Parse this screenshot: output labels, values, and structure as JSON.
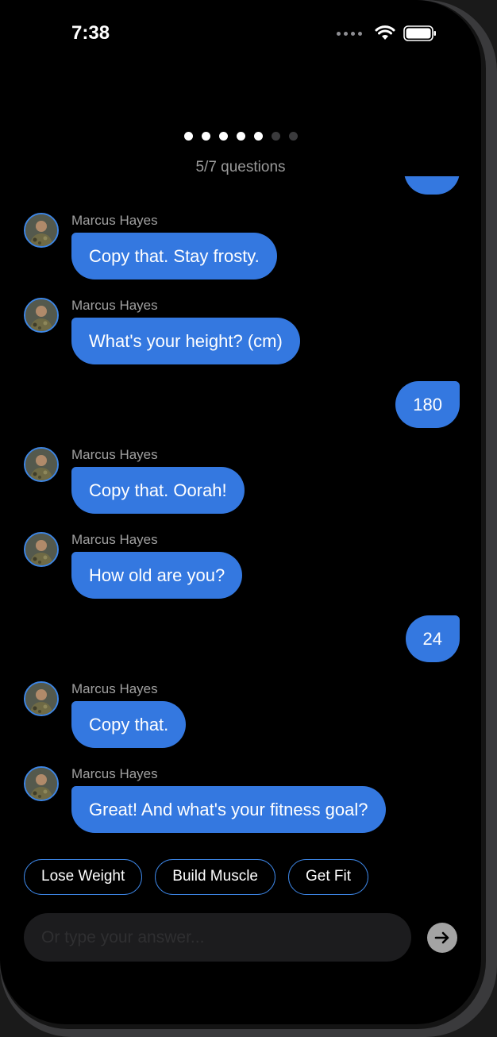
{
  "status_bar": {
    "time": "7:38"
  },
  "progress": {
    "label": "5/7 questions",
    "total": 7,
    "completed": 5
  },
  "messages": [
    {
      "from": "bot",
      "sender": "Marcus Hayes",
      "text": "Copy that. Stay frosty."
    },
    {
      "from": "bot",
      "sender": "Marcus Hayes",
      "text": "What's your height? (cm)"
    },
    {
      "from": "user",
      "text": "180"
    },
    {
      "from": "bot",
      "sender": "Marcus Hayes",
      "text": "Copy that. Oorah!"
    },
    {
      "from": "bot",
      "sender": "Marcus Hayes",
      "text": "How old are you?"
    },
    {
      "from": "user",
      "text": "24"
    },
    {
      "from": "bot",
      "sender": "Marcus Hayes",
      "text": "Copy that."
    },
    {
      "from": "bot",
      "sender": "Marcus Hayes",
      "text": "Great! And what's your fitness goal?"
    }
  ],
  "quick_replies": [
    "Lose Weight",
    "Build Muscle",
    "Get Fit"
  ],
  "input": {
    "placeholder": "Or type your answer...",
    "value": ""
  },
  "icons": {
    "send": "arrow-right-icon",
    "wifi": "wifi-icon",
    "battery": "battery-icon",
    "signal": "cellular-signal-icon"
  },
  "colors": {
    "accent": "#3478e0",
    "chip_border": "#3d86e6",
    "background": "#000000"
  }
}
